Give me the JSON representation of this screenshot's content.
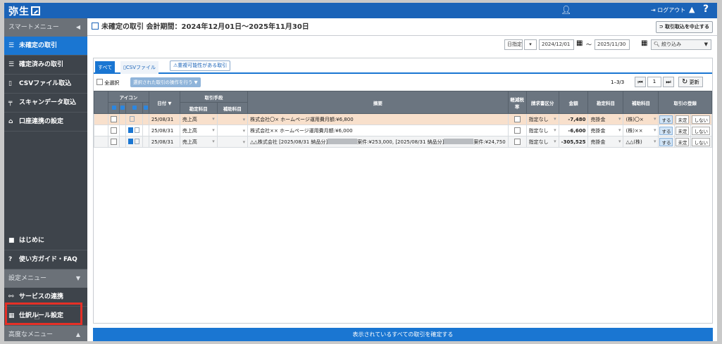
{
  "app": {
    "logo": "弥生",
    "logout": "ログアウト",
    "help": "?"
  },
  "sidebar": {
    "smart_menu": "スマートメニュー",
    "items": [
      {
        "label": "未確定の取引",
        "icon": "list-icon"
      },
      {
        "label": "確定済みの取引",
        "icon": "list-icon"
      },
      {
        "label": "CSVファイル取込",
        "icon": "file-icon"
      },
      {
        "label": "スキャンデータ取込",
        "icon": "scanner-icon"
      },
      {
        "label": "口座連携の設定",
        "icon": "bank-icon"
      }
    ],
    "hajimeni": "はじめに",
    "guide": "使い方ガイド・FAQ",
    "settings_menu": "設定メニュー",
    "service": "サービスの連携",
    "rules": "仕訳ルール設定",
    "advanced_menu": "高度なメニュー"
  },
  "main": {
    "title": "未確定の取引 会計期間：2024年12月01日～2025年11月30日",
    "stop_button": "取引取込を中止する",
    "date_mode": "日指定",
    "date_from": "2024/12/01",
    "date_sep": "～",
    "date_to": "2025/11/30",
    "filter": "絞り込み",
    "tabs": [
      "すべて",
      "CSVファイル"
    ],
    "dup_tab": "重複可能性がある取引",
    "select_all": "全選択",
    "bulk": "選択された取引の操作を行う ▼",
    "count": "1–3/3",
    "page": "1",
    "refresh": "更新",
    "confirm_all": "表示されているすべての取引を確定する"
  },
  "table": {
    "headers": {
      "icon": "アイコン",
      "date": "日付 ▼",
      "method": "取引手段",
      "acct": "勘定科目",
      "sub": "補助科目",
      "memo": "摘要",
      "reduced": "軽減税率",
      "invoice": "請求書区分",
      "amount": "金額",
      "acct2": "勘定科目",
      "sub2": "補助科目",
      "register": "取引の登録"
    },
    "rows": [
      {
        "date": "25/08/31",
        "acct": "売上高",
        "memo": "株式会社〇× ホームページ運用費月額:¥6,800",
        "invoice": "指定なし",
        "amount": "-7,480",
        "acct2": "売掛金",
        "sub2": "(株)〇×"
      },
      {
        "date": "25/08/31",
        "acct": "売上高",
        "memo": "株式会社×× ホームページ運用費月額:¥6,000",
        "invoice": "指定なし",
        "amount": "-6,600",
        "acct2": "売掛金",
        "sub2": "(株)××"
      },
      {
        "date": "25/08/31",
        "acct": "売上高",
        "memo_a": "△△株式会社 [2025/08/31 納品分]",
        "memo_b": "案件:¥253,000, [2025/08/31 納品分]",
        "memo_c": "案件:¥24,750",
        "invoice": "指定なし",
        "amount": "-305,525",
        "acct2": "売掛金",
        "sub2": "△△(株)"
      }
    ],
    "actions": [
      "する",
      "未定",
      "しない"
    ]
  },
  "colors": {
    "brand": "#1a63b8",
    "accent": "#1a76d2",
    "sidebar": "#3e444b",
    "highlight": "#e53027",
    "negative": "#e02020"
  }
}
